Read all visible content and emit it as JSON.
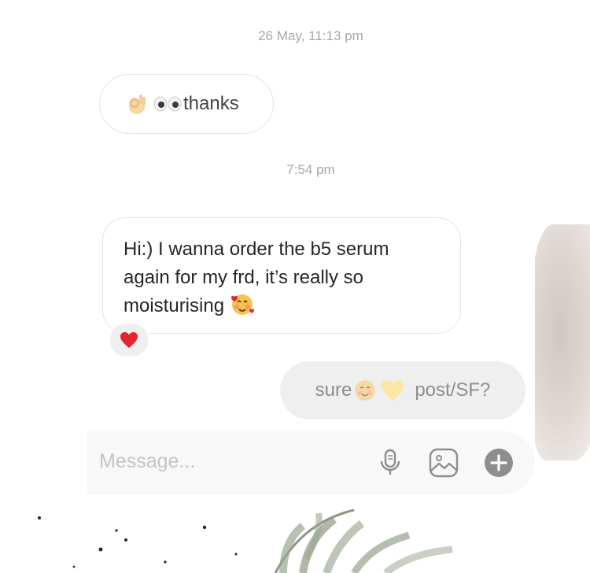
{
  "thread": {
    "timestamp_1": "26 May, 11:13 pm",
    "thanks_text": "thanks",
    "timestamp_2": "7:54 pm",
    "incoming_message": "Hi:) I wanna order the b5 serum\nagain for my frd, it’s really so\nmoisturising",
    "reaction": "red-heart",
    "outgoing": {
      "before": "sure",
      "after": "post/SF?"
    }
  },
  "composer": {
    "placeholder": "Message...",
    "icons": [
      "microphone-icon",
      "gallery-icon",
      "add-icon"
    ]
  },
  "colors": {
    "timestamp": "#a8a8a8",
    "outgoing_bubble": "#efefef",
    "composer_bg": "#f8f8f8",
    "reaction_heart": "#e3262c"
  }
}
